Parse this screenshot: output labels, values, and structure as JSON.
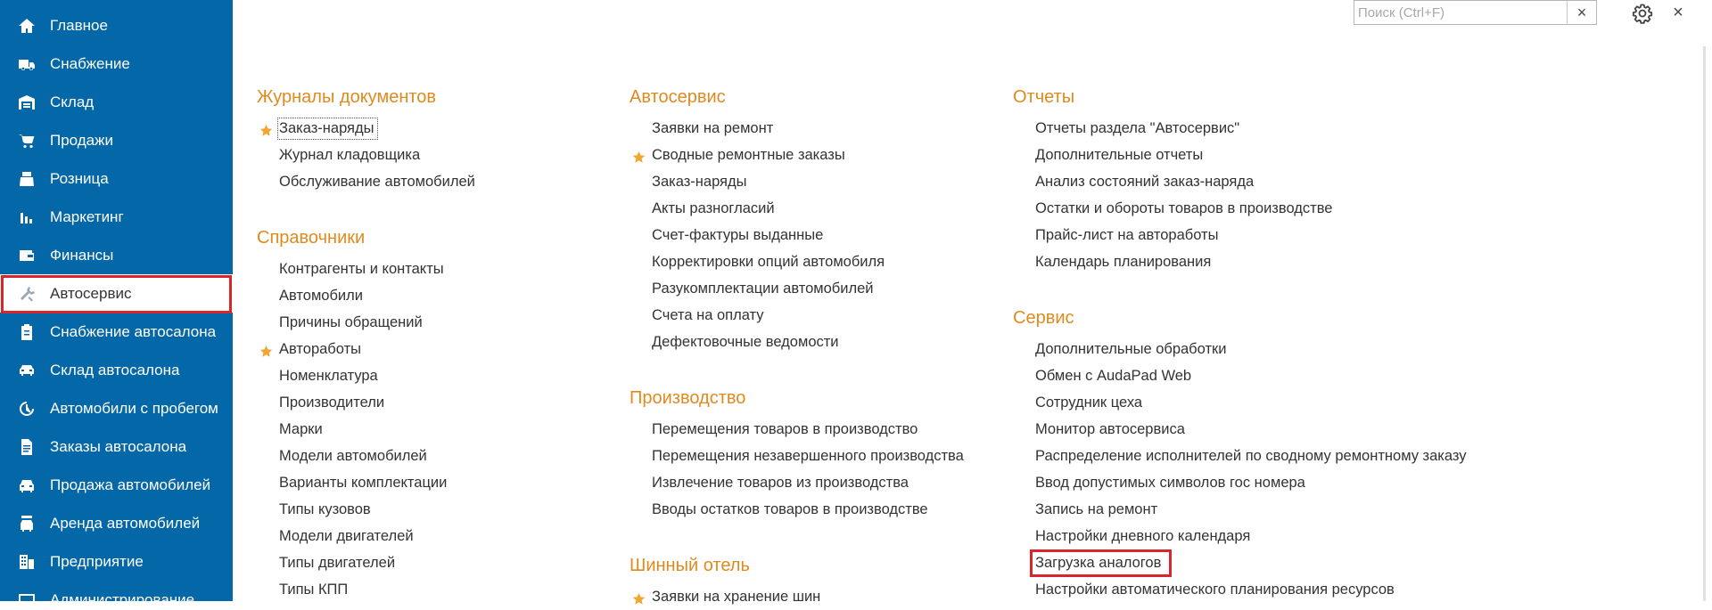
{
  "sidebar": {
    "items": [
      {
        "label": "Главное",
        "icon": "home-icon"
      },
      {
        "label": "Снабжение",
        "icon": "truck-icon"
      },
      {
        "label": "Склад",
        "icon": "warehouse-icon"
      },
      {
        "label": "Продажи",
        "icon": "cart-icon"
      },
      {
        "label": "Розница",
        "icon": "register-icon"
      },
      {
        "label": "Маркетинг",
        "icon": "bar-chart-icon"
      },
      {
        "label": "Финансы",
        "icon": "wallet-icon"
      },
      {
        "label": "Автосервис",
        "icon": "tools-icon",
        "active": true
      },
      {
        "label": "Снабжение автосалона",
        "icon": "clipboard-icon"
      },
      {
        "label": "Склад автосалона",
        "icon": "car-garage-icon"
      },
      {
        "label": "Автомобили с пробегом",
        "icon": "odometer-icon"
      },
      {
        "label": "Заказы автосалона",
        "icon": "document-icon"
      },
      {
        "label": "Продажа автомобилей",
        "icon": "car-icon"
      },
      {
        "label": "Аренда автомобилей",
        "icon": "car-key-icon"
      },
      {
        "label": "Предприятие",
        "icon": "building-icon"
      },
      {
        "label": "Администрирование",
        "icon": "monitor-icon"
      }
    ]
  },
  "toolbar": {
    "search_placeholder": "Поиск (Ctrl+F)",
    "search_value": "",
    "clear_label": "×",
    "close_label": "×"
  },
  "colors": {
    "sidebar_bg": "#0467a8",
    "section_title": "#e08a1e",
    "highlight_frame": "#d9262b",
    "star": "#f2a531"
  },
  "columns": [
    {
      "sections": [
        {
          "title": "Журналы документов",
          "items": [
            {
              "label": "Заказ-наряды",
              "starred": true,
              "focused": true
            },
            {
              "label": "Журнал кладовщика"
            },
            {
              "label": "Обслуживание автомобилей"
            }
          ]
        },
        {
          "title": "Справочники",
          "items": [
            {
              "label": "Контрагенты и контакты"
            },
            {
              "label": "Автомобили"
            },
            {
              "label": "Причины обращений"
            },
            {
              "label": "Автоработы",
              "starred": true
            },
            {
              "label": "Номенклатура"
            },
            {
              "label": "Производители"
            },
            {
              "label": "Марки"
            },
            {
              "label": "Модели автомобилей"
            },
            {
              "label": "Варианты комплектации"
            },
            {
              "label": "Типы кузовов"
            },
            {
              "label": "Модели двигателей"
            },
            {
              "label": "Типы двигателей"
            },
            {
              "label": "Типы КПП"
            }
          ]
        }
      ]
    },
    {
      "sections": [
        {
          "title": "Автосервис",
          "items": [
            {
              "label": "Заявки на ремонт"
            },
            {
              "label": "Сводные ремонтные заказы",
              "starred": true
            },
            {
              "label": "Заказ-наряды"
            },
            {
              "label": "Акты разногласий"
            },
            {
              "label": "Счет-фактуры выданные"
            },
            {
              "label": "Корректировки опций автомобиля"
            },
            {
              "label": "Разукомплектации автомобилей"
            },
            {
              "label": "Счета на оплату"
            },
            {
              "label": "Дефектовочные ведомости"
            }
          ]
        },
        {
          "title": "Производство",
          "items": [
            {
              "label": "Перемещения товаров в производство"
            },
            {
              "label": "Перемещения незавершенного производства"
            },
            {
              "label": "Извлечение товаров из производства"
            },
            {
              "label": "Вводы остатков товаров в производстве"
            }
          ]
        },
        {
          "title": "Шинный отель",
          "items": [
            {
              "label": "Заявки на хранение шин",
              "starred": true
            }
          ]
        }
      ]
    },
    {
      "sections": [
        {
          "title": "Отчеты",
          "items": [
            {
              "label": "Отчеты раздела \"Автосервис\""
            },
            {
              "label": "Дополнительные отчеты"
            },
            {
              "label": "Анализ состояний заказ-наряда"
            },
            {
              "label": "Остатки и обороты товаров в производстве"
            },
            {
              "label": "Прайс-лист на автоработы"
            },
            {
              "label": "Календарь планирования"
            }
          ]
        },
        {
          "title": "Сервис",
          "items": [
            {
              "label": "Дополнительные обработки"
            },
            {
              "label": "Обмен с AudaPad Web"
            },
            {
              "label": "Сотрудник цеха"
            },
            {
              "label": "Монитор автосервиса"
            },
            {
              "label": "Распределение исполнителей по сводному ремонтному заказу"
            },
            {
              "label": "Ввод допустимых символов гос номера"
            },
            {
              "label": "Запись на ремонт"
            },
            {
              "label": "Настройки дневного календаря"
            },
            {
              "label": "Загрузка аналогов",
              "highlighted": true
            },
            {
              "label": "Настройки автоматического планирования ресурсов"
            }
          ]
        }
      ]
    }
  ]
}
